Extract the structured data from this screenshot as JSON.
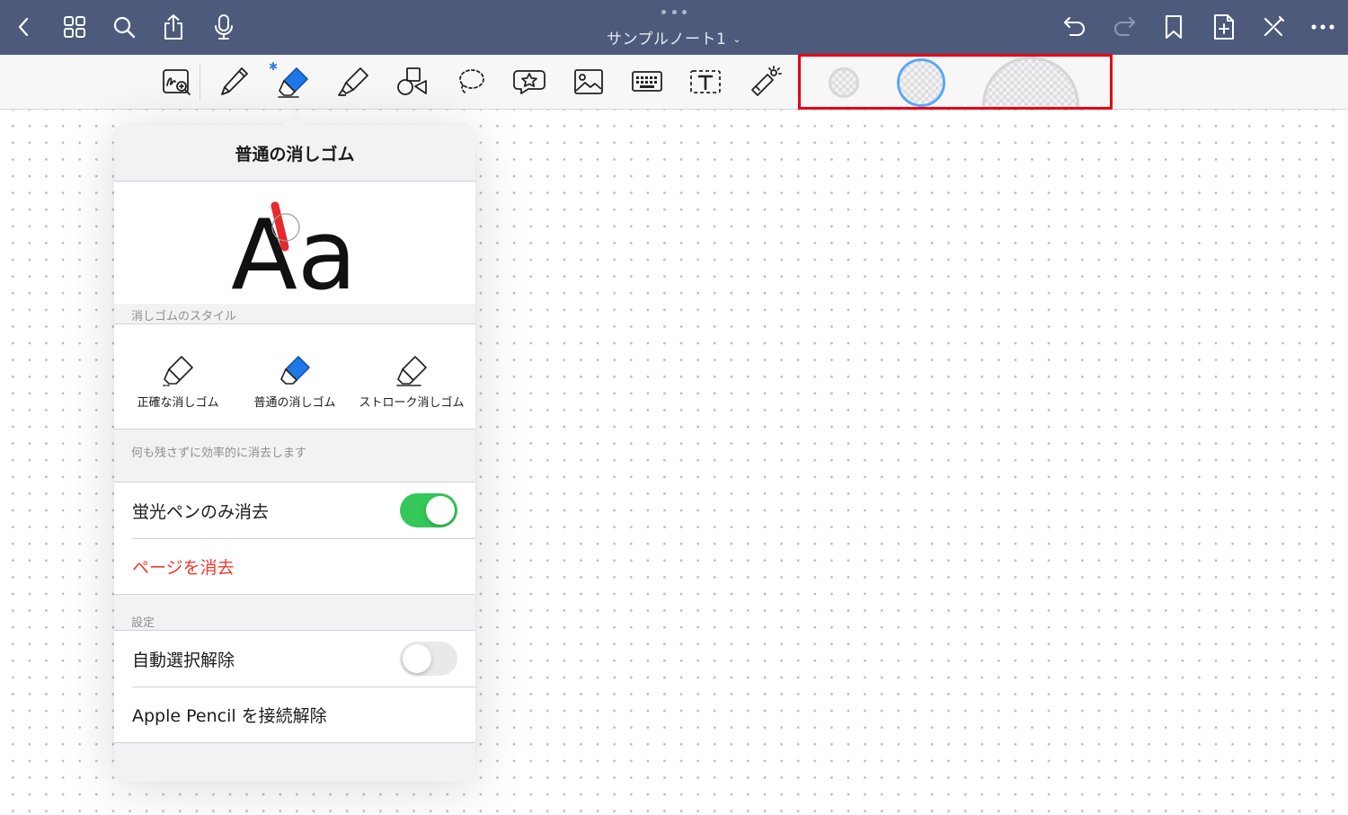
{
  "header": {
    "title": "サンプルノート1",
    "title_chevron": "⌄",
    "icons": [
      "back-icon",
      "grid-icon",
      "search-icon",
      "share-icon",
      "microphone-icon",
      "undo-icon",
      "redo-icon",
      "bookmark-icon",
      "add-page-icon",
      "close-icon",
      "more-icon"
    ]
  },
  "toolbar": {
    "tools": [
      "zoom-window-icon",
      "pen-icon",
      "eraser-icon",
      "highlighter-icon",
      "shapes-icon",
      "lasso-icon",
      "sticker-icon",
      "image-icon",
      "keyboard-icon",
      "text-box-icon",
      "laser-pointer-icon"
    ],
    "bluetooth_mark": "✱",
    "eraser_sizes": [
      "small",
      "medium",
      "large"
    ],
    "selected_size": "medium"
  },
  "eraser_popover": {
    "title": "普通の消しゴム",
    "preview_text": "Aa",
    "style_section_label": "消しゴムのスタイル",
    "styles": [
      {
        "label": "正確な消しゴム",
        "selected": false
      },
      {
        "label": "普通の消しゴム",
        "selected": true
      },
      {
        "label": "ストローク消しゴム",
        "selected": false
      }
    ],
    "style_description": "何も残さずに効率的に消去します",
    "highlighter_only_label": "蛍光ペンのみ消去",
    "highlighter_only_on": true,
    "clear_page_label": "ページを消去",
    "settings_section_label": "設定",
    "auto_deselect_label": "自動選択解除",
    "auto_deselect_on": false,
    "disconnect_pencil_label": "Apple Pencil を接続解除"
  },
  "colors": {
    "header_bg": "#4d5a7c",
    "accent_blue": "#2f7be8",
    "switch_on": "#34c759",
    "destructive_red": "#f0392d",
    "highlight_frame": "#e60012"
  }
}
